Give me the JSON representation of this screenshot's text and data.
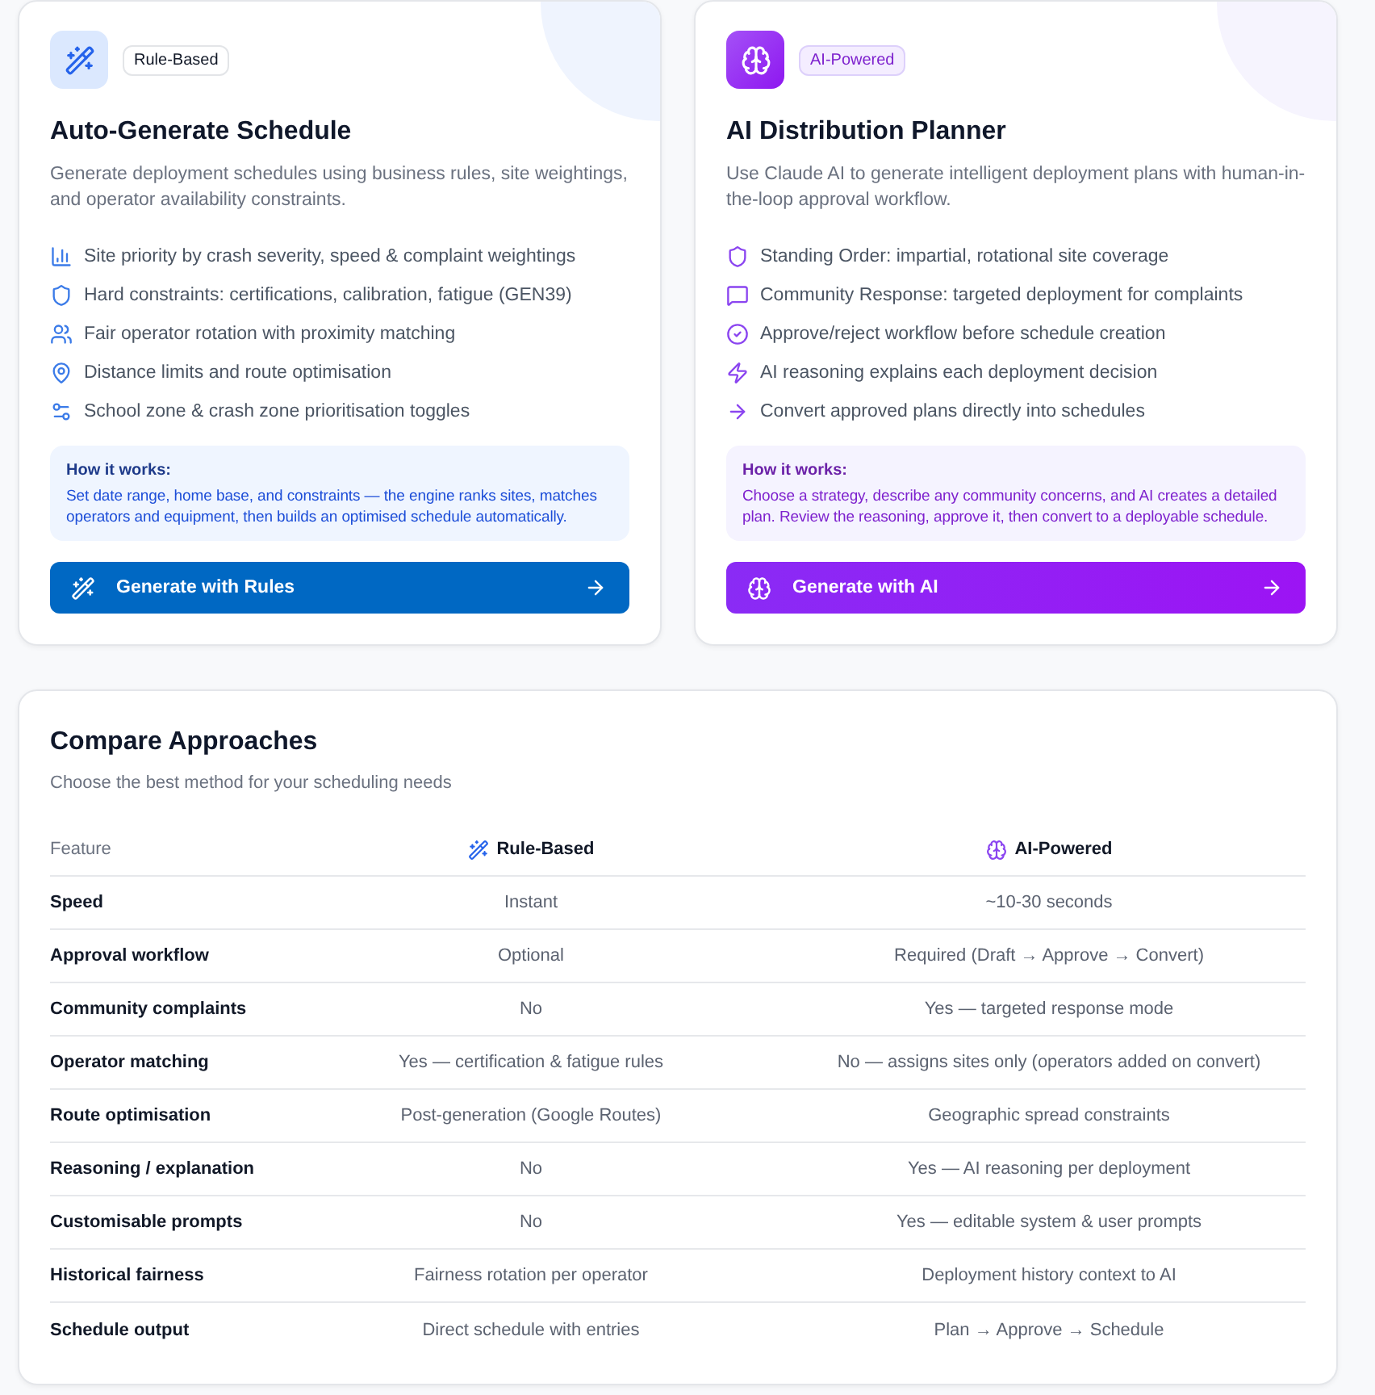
{
  "cards": [
    {
      "kind": "rules",
      "badge": "Rule-Based",
      "title": "Auto-Generate Schedule",
      "description": "Generate deployment schedules using business rules, site weightings, and operator availability constraints.",
      "features": [
        "Site priority by crash severity, speed & complaint weightings",
        "Hard constraints: certifications, calibration, fatigue (GEN39)",
        "Fair operator rotation with proximity matching",
        "Distance limits and route optimisation",
        "School zone & crash zone prioritisation toggles"
      ],
      "how_it_works": {
        "heading": "How it works:",
        "text": "Set date range, home base, and constraints — the engine ranks sites, matches operators and equipment, then builds an optimised schedule automatically."
      },
      "button": "Generate with Rules"
    },
    {
      "kind": "ai",
      "badge": "AI-Powered",
      "title": "AI Distribution Planner",
      "description": "Use Claude AI to generate intelligent deployment plans with human-in-the-loop approval workflow.",
      "features": [
        "Standing Order: impartial, rotational site coverage",
        "Community Response: targeted deployment for complaints",
        "Approve/reject workflow before schedule creation",
        "AI reasoning explains each deployment decision",
        "Convert approved plans directly into schedules"
      ],
      "how_it_works": {
        "heading": "How it works:",
        "text": "Choose a strategy, describe any community concerns, and AI creates a detailed plan. Review the reasoning, approve it, then convert to a deployable schedule."
      },
      "button": "Generate with AI"
    }
  ],
  "comparison": {
    "title": "Compare Approaches",
    "subtitle": "Choose the best method for your scheduling needs",
    "columns": [
      {
        "kind": "plain",
        "label": "Feature"
      },
      {
        "kind": "rules",
        "label": "Rule-Based"
      },
      {
        "kind": "ai",
        "label": "AI-Powered"
      }
    ],
    "rows": [
      [
        "Speed",
        "Instant",
        "~10-30 seconds"
      ],
      [
        "Approval workflow",
        "Optional",
        "Required (Draft → Approve → Convert)"
      ],
      [
        "Community complaints",
        "No",
        "Yes — targeted response mode"
      ],
      [
        "Operator matching",
        "Yes — certification & fatigue rules",
        "No — assigns sites only (operators added on convert)"
      ],
      [
        "Route optimisation",
        "Post-generation (Google Routes)",
        "Geographic spread constraints"
      ],
      [
        "Reasoning / explanation",
        "No",
        "Yes — AI reasoning per deployment"
      ],
      [
        "Customisable prompts",
        "No",
        "Yes — editable system & user prompts"
      ],
      [
        "Historical fairness",
        "Fairness rotation per operator",
        "Deployment history context to AI"
      ],
      [
        "Schedule output",
        "Direct schedule with entries",
        "Plan → Approve → Schedule"
      ]
    ]
  }
}
